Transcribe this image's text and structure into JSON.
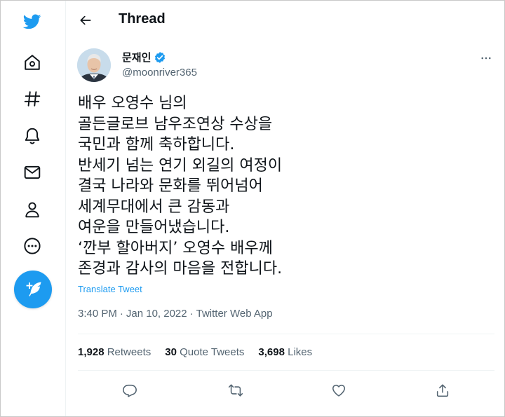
{
  "header": {
    "title": "Thread"
  },
  "tweet": {
    "author_name": "문재인",
    "handle": "@moonriver365",
    "lines": [
      "배우 오영수 님의",
      "골든글로브 남우조연상 수상을",
      "국민과 함께 축하합니다.",
      "반세기 넘는 연기 외길의 여정이",
      "결국 나라와 문화를 뛰어넘어",
      "세계무대에서 큰 감동과",
      "여운을 만들어냈습니다.",
      "‘깐부 할아버지’ 오영수 배우께",
      "존경과 감사의 마음을 전합니다."
    ],
    "translate_label": "Translate Tweet",
    "time": "3:40 PM",
    "date": "Jan 10, 2022",
    "separator": "·",
    "source": "Twitter Web App"
  },
  "stats": {
    "retweets_count": "1,928",
    "retweets_label": "Retweets",
    "quotes_count": "30",
    "quotes_label": "Quote Tweets",
    "likes_count": "3,698",
    "likes_label": "Likes"
  },
  "icons": {
    "logo": "twitter-bird-icon",
    "nav": [
      "home-icon",
      "hashtag-icon",
      "bell-icon",
      "mail-icon",
      "profile-icon",
      "more-circle-icon"
    ],
    "fab": "compose-feather-icon",
    "actions": [
      "reply-icon",
      "retweet-icon",
      "like-icon",
      "share-icon"
    ]
  },
  "colors": {
    "brand": "#1d9bf0",
    "text": "#0f1419",
    "muted": "#536471",
    "verified": "#1d9bf0"
  }
}
